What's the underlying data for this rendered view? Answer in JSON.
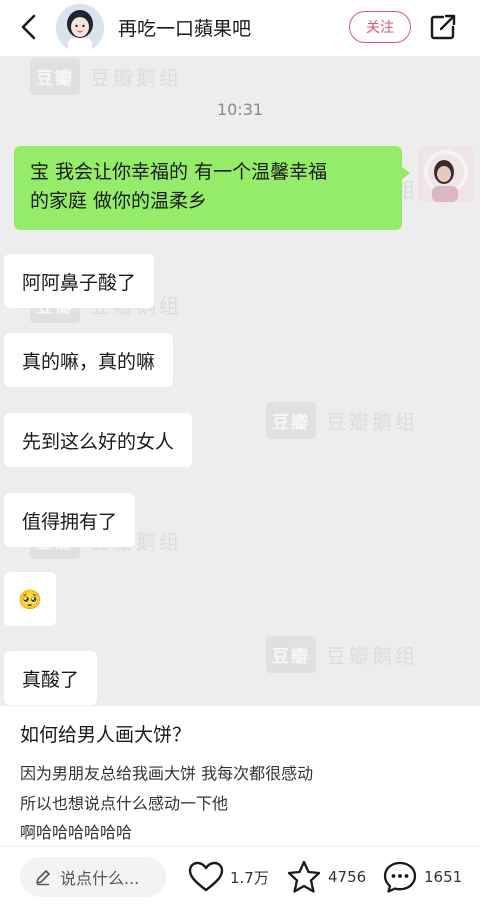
{
  "header": {
    "author_name": "再吃一口蘋果吧",
    "follow_label": "关注",
    "back_icon": "chevron-left-icon",
    "share_icon": "share-icon",
    "accent_color": "#e0566a"
  },
  "watermark": {
    "badge": "豆瓣",
    "text": "豆瓣鹅组"
  },
  "chat": {
    "time": "10:31",
    "self_message": {
      "line1": "宝 我会让你幸福的 有一个温馨幸福",
      "line2": "的家庭 做你的温柔乡"
    },
    "messages": [
      "阿阿鼻子酸了",
      "真的嘛，真的嘛",
      "先到这么好的女人",
      "值得拥有了",
      "🥺",
      "真酸了"
    ]
  },
  "post": {
    "title": "如何给男人画大饼？",
    "lines": [
      "因为男朋友总给我画大饼 我每次都很感动",
      "所以也想说点什么感动一下他",
      "啊哈哈哈哈哈哈"
    ]
  },
  "bottom_bar": {
    "comment_placeholder": "说点什么...",
    "likes": "1.7万",
    "favorites": "4756",
    "comments": "1651",
    "like_icon": "heart-icon",
    "favorite_icon": "star-icon",
    "comment_icon": "comment-icon",
    "edit_icon": "pencil-icon"
  }
}
